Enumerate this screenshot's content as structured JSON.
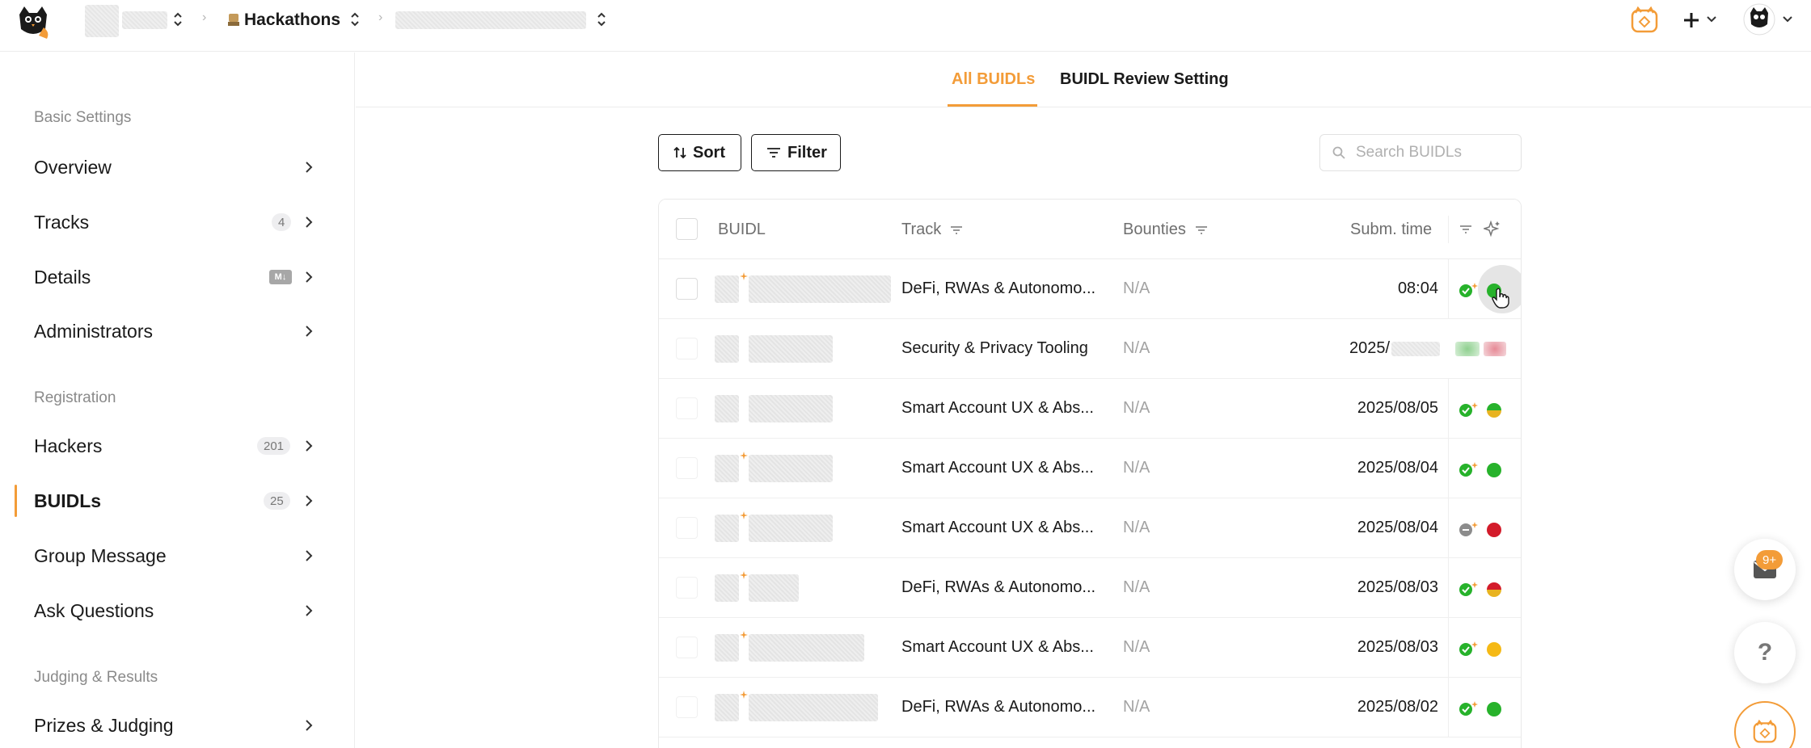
{
  "header": {
    "breadcrumb_project": "Hackathons",
    "icons": [
      "logo-icon",
      "chevron-updown-icon",
      "chevron-right-icon",
      "cat-badge-icon",
      "plus-icon",
      "chevron-down-icon",
      "avatar"
    ]
  },
  "sidebar": {
    "sections": [
      {
        "title": "Basic Settings",
        "items": [
          {
            "label": "Overview",
            "badge": ""
          },
          {
            "label": "Tracks",
            "badge": "4"
          },
          {
            "label": "Details",
            "badge": "M↓"
          },
          {
            "label": "Administrators",
            "badge": ""
          }
        ]
      },
      {
        "title": "Registration",
        "items": [
          {
            "label": "Hackers",
            "badge": "201"
          },
          {
            "label": "BUIDLs",
            "badge": "25",
            "active": true
          },
          {
            "label": "Group Message",
            "badge": ""
          },
          {
            "label": "Ask Questions",
            "badge": ""
          }
        ]
      },
      {
        "title": "Judging & Results",
        "items": [
          {
            "label": "Prizes & Judging",
            "badge": ""
          }
        ]
      }
    ]
  },
  "tabs": [
    {
      "label": "All BUIDLs",
      "active": true
    },
    {
      "label": "BUIDL Review Setting",
      "active": false
    }
  ],
  "toolbar": {
    "sort_label": "Sort",
    "filter_label": "Filter",
    "search_placeholder": "Search BUIDLs"
  },
  "table": {
    "columns": [
      "BUIDL",
      "Track",
      "Bounties",
      "Subm. time"
    ],
    "rows": [
      {
        "track": "DeFi, RWAs & Autonomo...",
        "bounties": "N/A",
        "time": "08:04",
        "status": "approved",
        "dot_color": "#27b22b"
      },
      {
        "track": "Security & Privacy Tooling",
        "bounties": "N/A",
        "time": "2025/",
        "status": "approved",
        "dot_color": "#e0556a"
      },
      {
        "track": "Smart Account UX & Abs...",
        "bounties": "N/A",
        "time": "2025/08/05",
        "status": "approved",
        "dot_color": "#e8b320"
      },
      {
        "track": "Smart Account UX & Abs...",
        "bounties": "N/A",
        "time": "2025/08/04",
        "status": "approved",
        "dot_color": "#27b22b"
      },
      {
        "track": "Smart Account UX & Abs...",
        "bounties": "N/A",
        "time": "2025/08/04",
        "status": "neutral",
        "dot_color": "#d31b2a"
      },
      {
        "track": "DeFi, RWAs & Autonomo...",
        "bounties": "N/A",
        "time": "2025/08/03",
        "status": "approved",
        "dot_color": "#e8b320"
      },
      {
        "track": "Smart Account UX & Abs...",
        "bounties": "N/A",
        "time": "2025/08/03",
        "status": "approved",
        "dot_color": "#f5b915"
      },
      {
        "track": "DeFi, RWAs & Autonomo...",
        "bounties": "N/A",
        "time": "2025/08/02",
        "status": "approved",
        "dot_color": "#27b22b"
      }
    ]
  },
  "floating": {
    "mail_badge": "9+",
    "help_label": "?"
  },
  "colors": {
    "accent": "#f39c38",
    "text": "#1a1a1a",
    "muted": "#8a8a8a"
  }
}
